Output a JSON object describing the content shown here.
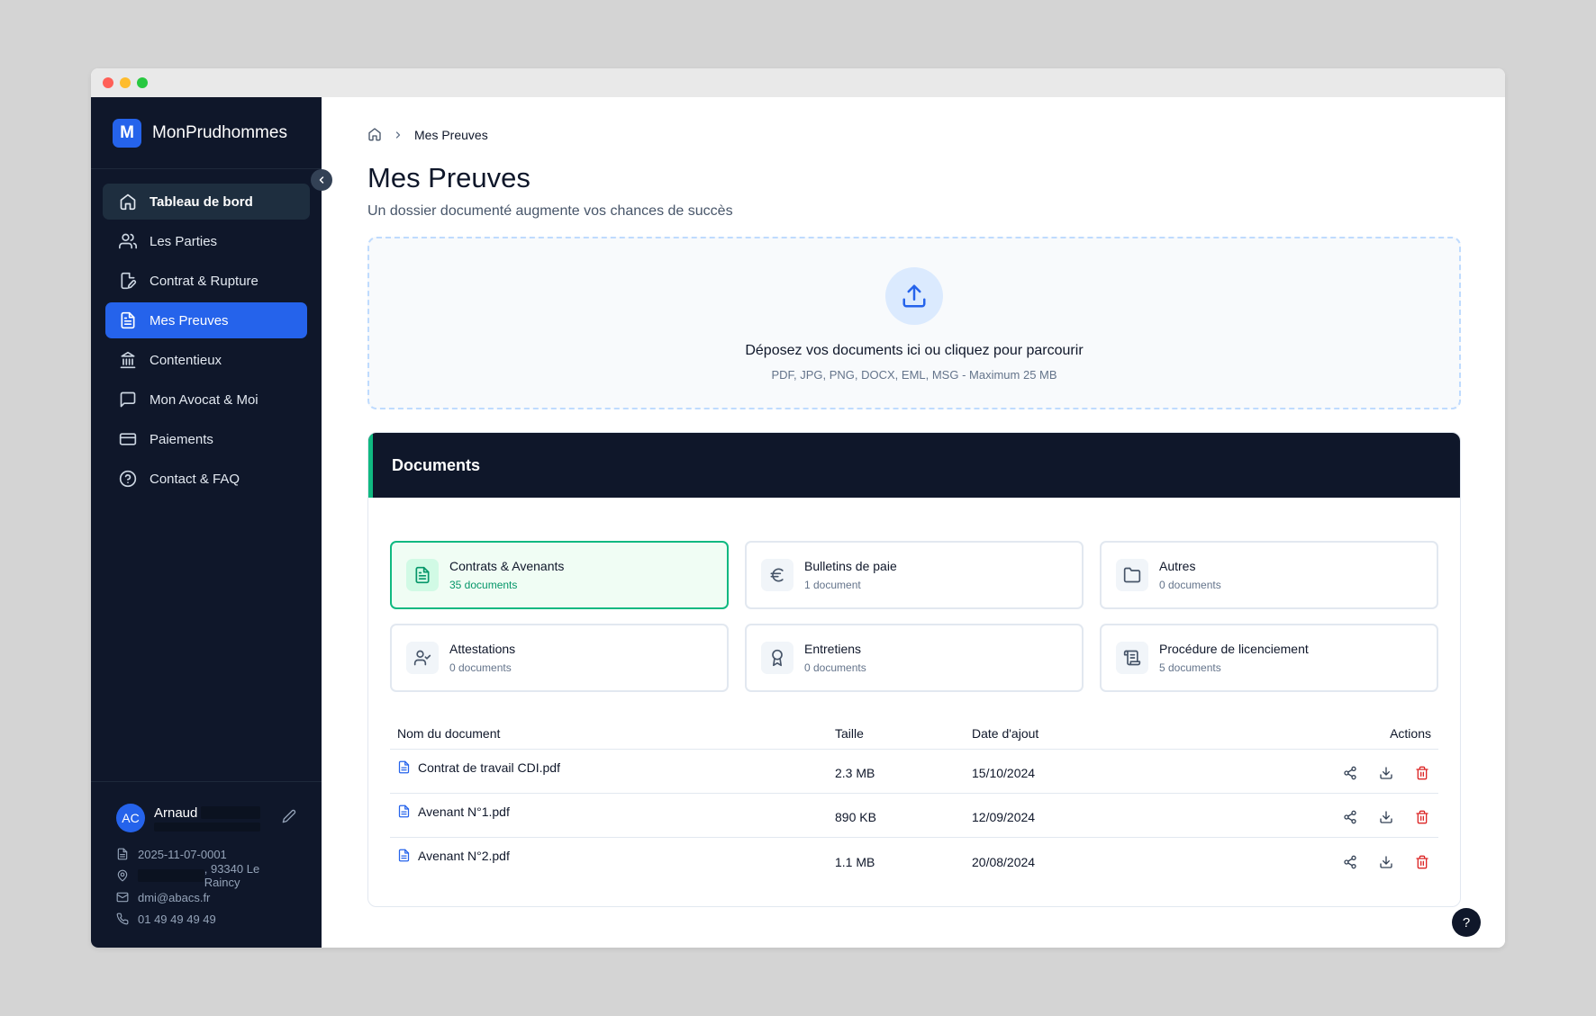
{
  "window": {
    "dots": [
      "#ff5f57",
      "#febc2e",
      "#28c840"
    ]
  },
  "sidebar": {
    "brand_logo": "M",
    "brand_name": "MonPrudhommes",
    "items": [
      {
        "label": "Tableau de bord",
        "icon": "home-icon"
      },
      {
        "label": "Les Parties",
        "icon": "users-icon"
      },
      {
        "label": "Contrat & Rupture",
        "icon": "file-edit-icon"
      },
      {
        "label": "Mes Preuves",
        "icon": "file-text-icon"
      },
      {
        "label": "Contentieux",
        "icon": "landmark-icon"
      },
      {
        "label": "Mon Avocat & Moi",
        "icon": "message-square-icon"
      },
      {
        "label": "Paiements",
        "icon": "credit-card-icon"
      },
      {
        "label": "Contact & FAQ",
        "icon": "help-circle-icon"
      }
    ],
    "user": {
      "initials": "AC",
      "name": "Arnaud",
      "case_number": "2025-11-07-0001",
      "address": ", 93340 Le Raincy",
      "email": "dmi@abacs.fr",
      "phone": "01 49 49 49 49"
    }
  },
  "breadcrumb": {
    "current": "Mes Preuves"
  },
  "page": {
    "title": "Mes Preuves",
    "subtitle": "Un dossier documenté augmente vos chances de succès"
  },
  "dropzone": {
    "title": "Déposez vos documents ici ou cliquez pour parcourir",
    "subtitle": "PDF, JPG, PNG, DOCX, EML, MSG - Maximum 25 MB"
  },
  "documents": {
    "header": "Documents",
    "categories": [
      {
        "name": "Contrats & Avenants",
        "count": "35 documents",
        "icon": "file-text-icon"
      },
      {
        "name": "Bulletins de paie",
        "count": "1 document",
        "icon": "euro-icon"
      },
      {
        "name": "Autres",
        "count": "0 documents",
        "icon": "folder-icon"
      },
      {
        "name": "Attestations",
        "count": "0 documents",
        "icon": "user-check-icon"
      },
      {
        "name": "Entretiens",
        "count": "0 documents",
        "icon": "award-icon"
      },
      {
        "name": "Procédure de licenciement",
        "count": "5 documents",
        "icon": "scroll-icon"
      }
    ],
    "table": {
      "headers": {
        "name": "Nom du document",
        "size": "Taille",
        "date": "Date d'ajout",
        "actions": "Actions"
      },
      "rows": [
        {
          "name": "Contrat de travail CDI.pdf",
          "size": "2.3 MB",
          "date": "15/10/2024"
        },
        {
          "name": "Avenant N°1.pdf",
          "size": "890 KB",
          "date": "12/09/2024"
        },
        {
          "name": "Avenant N°2.pdf",
          "size": "1.1 MB",
          "date": "20/08/2024"
        }
      ]
    }
  },
  "help": {
    "label": "?"
  },
  "colors": {
    "sidebar_bg": "#0f172a",
    "accent": "#2563eb",
    "success": "#10b981",
    "danger": "#dc2626"
  }
}
